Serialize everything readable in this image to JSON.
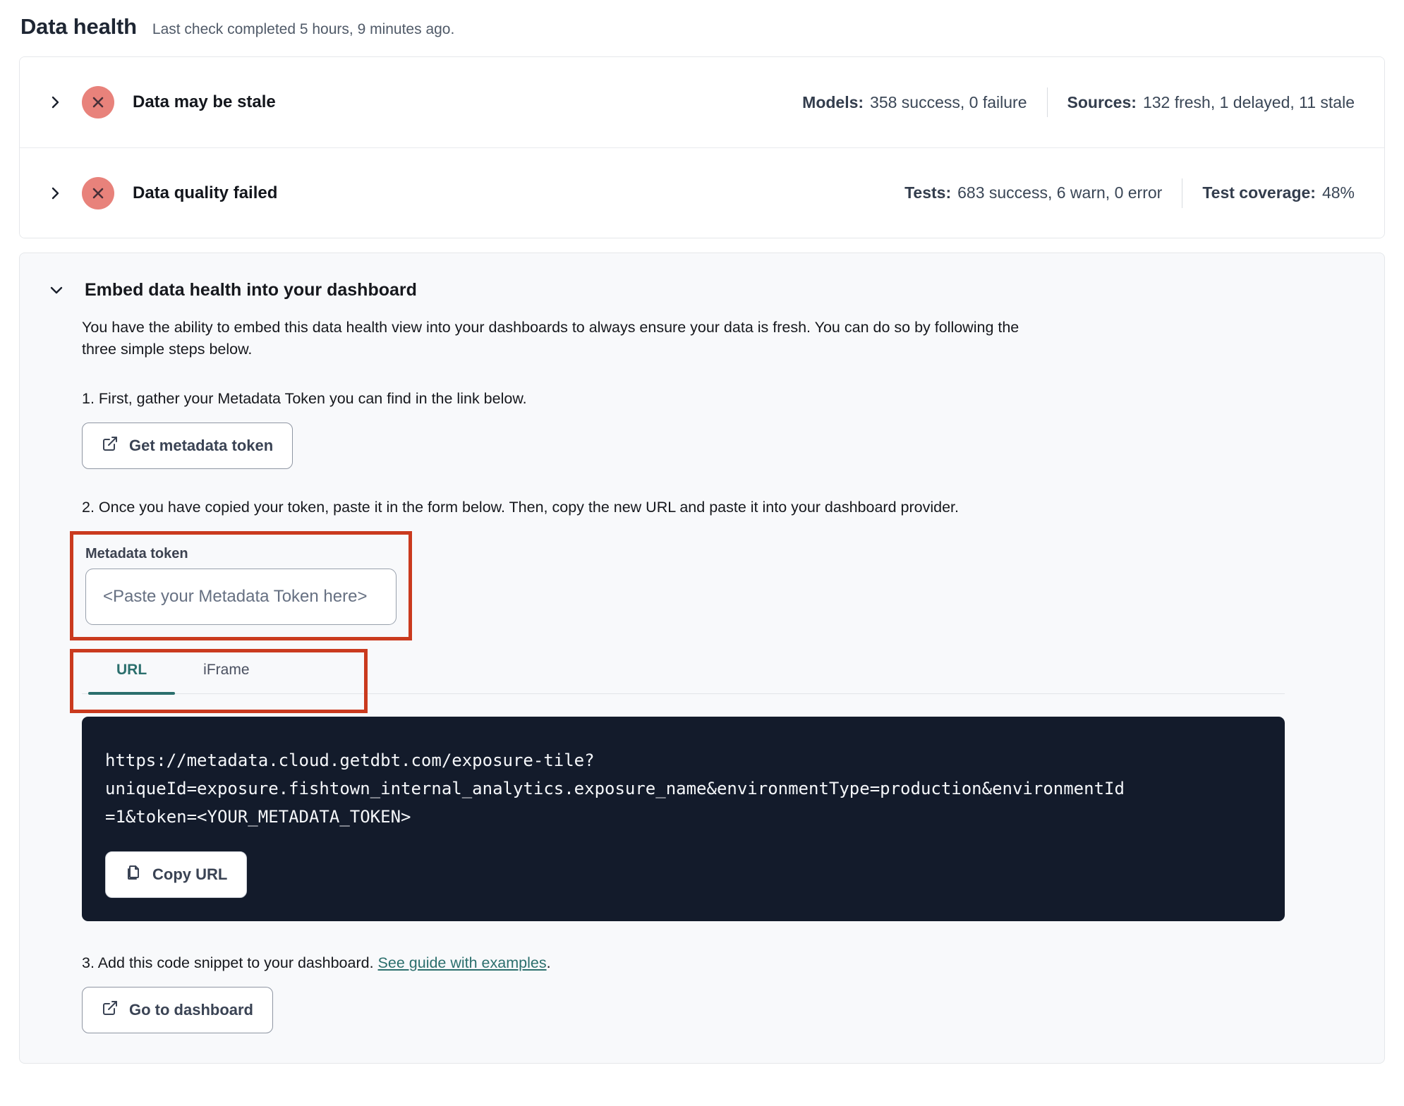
{
  "page": {
    "title": "Data health",
    "subtitle": "Last check completed 5 hours, 9 minutes ago."
  },
  "status_rows": [
    {
      "label": "Data may be stale",
      "status_icon": "x-circle",
      "stats": [
        {
          "label": "Models:",
          "value": "358 success, 0 failure"
        },
        {
          "label": "Sources:",
          "value": "132 fresh, 1 delayed, 11 stale"
        }
      ]
    },
    {
      "label": "Data quality failed",
      "status_icon": "x-circle",
      "stats": [
        {
          "label": "Tests:",
          "value": "683 success, 6 warn, 0 error"
        },
        {
          "label": "Test coverage:",
          "value": "48%"
        }
      ]
    }
  ],
  "embed": {
    "title": "Embed data health into your dashboard",
    "description": "You have the ability to embed this data health view into your dashboards to always ensure your data is fresh. You can do so by following the three simple steps below.",
    "step1": {
      "text": "1. First, gather your Metadata Token you can find in the link below.",
      "button_label": "Get metadata token"
    },
    "step2": {
      "text": "2. Once you have copied your token, paste it in the form below. Then, copy the new URL and paste it into your dashboard provider.",
      "token_label": "Metadata token",
      "token_placeholder": "<Paste your Metadata Token here>",
      "token_value": ""
    },
    "tabs": [
      {
        "label": "URL",
        "active": true
      },
      {
        "label": "iFrame",
        "active": false
      }
    ],
    "code": {
      "url": "https://metadata.cloud.getdbt.com/exposure-tile?uniqueId=exposure.fishtown_internal_analytics.exposure_name&environmentType=production&environmentId=1&token=<YOUR_METADATA_TOKEN>",
      "lines": [
        "https://metadata.cloud.getdbt.com/exposure-tile?",
        "uniqueId=exposure.fishtown_internal_analytics.exposure_name&environmentType=production&environmentId",
        "=1&token=<YOUR_METADATA_TOKEN>"
      ],
      "copy_label": "Copy URL"
    },
    "step3": {
      "text_before": "3. Add this code snippet to your dashboard. ",
      "link": "See guide with examples",
      "text_after": ".",
      "button_label": "Go to dashboard"
    }
  },
  "colors": {
    "error_badge": "#e8827b",
    "error_badge_glyph": "#472f38",
    "accent_teal": "#2b6f6d",
    "annotation_red": "#ca3a1e",
    "code_background": "#131b2b",
    "card_background": "#f8f9fb"
  }
}
